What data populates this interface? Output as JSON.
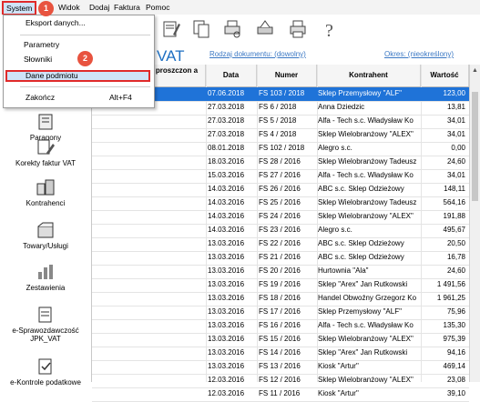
{
  "menubar": {
    "items": [
      "System",
      "Widok",
      "Dodaj",
      "Faktura",
      "Pomoc"
    ]
  },
  "dropdown": {
    "items": [
      {
        "label": "Eksport danych..."
      },
      {
        "label": "Parametry"
      },
      {
        "label": "Słowniki"
      },
      {
        "label": "Dane podmiotu"
      },
      {
        "label": "Zakończ",
        "shortcut": "Alt+F4"
      }
    ]
  },
  "badges": [
    "1",
    "2"
  ],
  "header": {
    "title": "VAT",
    "filter_doc": "Rodzaj dokumentu: (dowolny)",
    "filter_period": "Okres: (nieokreślony)"
  },
  "sidebar": {
    "items": [
      {
        "label": "Paragony",
        "icon": "receipt-icon"
      },
      {
        "label": "Korekty faktur VAT",
        "icon": "invoice-correction-icon"
      },
      {
        "label": "Kontrahenci",
        "icon": "contractors-icon"
      },
      {
        "label": "Towary/Usługi",
        "icon": "goods-icon"
      },
      {
        "label": "Zestawienia",
        "icon": "reports-icon"
      },
      {
        "label": "e-Sprawozdawczość JPK_VAT",
        "icon": "jpk-icon"
      },
      {
        "label": "e-Kontrole podatkowe",
        "icon": "tax-control-icon"
      }
    ]
  },
  "table": {
    "columns": [
      "proszczon a",
      "Data",
      "Numer",
      "Kontrahent",
      "Wartość"
    ],
    "rows": [
      {
        "date": "07.06.2018",
        "number": "FS 103 / 2018",
        "kontrahent": "Sklep Przemysłowy \"ALF\"",
        "value": "123,00",
        "selected": true
      },
      {
        "date": "27.03.2018",
        "number": "FS 6 / 2018",
        "kontrahent": "Anna Dziedzic",
        "value": "13,81"
      },
      {
        "date": "27.03.2018",
        "number": "FS 5 / 2018",
        "kontrahent": "Alfa - Tech s.c. Władysław Ko",
        "value": "34,01"
      },
      {
        "date": "27.03.2018",
        "number": "FS 4 / 2018",
        "kontrahent": "Sklep Wielobranżowy \"ALEX\"",
        "value": "34,01"
      },
      {
        "date": "08.01.2018",
        "number": "FS 102 / 2018",
        "kontrahent": "Alegro s.c.",
        "value": "0,00"
      },
      {
        "date": "18.03.2016",
        "number": "FS 28 / 2016",
        "kontrahent": "Sklep Wielobranżowy Tadeusz",
        "value": "24,60"
      },
      {
        "date": "15.03.2016",
        "number": "FS 27 / 2016",
        "kontrahent": "Alfa - Tech s.c. Władysław Ko",
        "value": "34,01"
      },
      {
        "date": "14.03.2016",
        "number": "FS 26 / 2016",
        "kontrahent": "ABC s.c. Sklep Odzieżowy",
        "value": "148,11"
      },
      {
        "date": "14.03.2016",
        "number": "FS 25 / 2016",
        "kontrahent": "Sklep Wielobranżowy Tadeusz",
        "value": "564,16"
      },
      {
        "date": "14.03.2016",
        "number": "FS 24 / 2016",
        "kontrahent": "Sklep Wielobranżowy \"ALEX\"",
        "value": "191,88"
      },
      {
        "date": "14.03.2016",
        "number": "FS 23 / 2016",
        "kontrahent": "Alegro s.c.",
        "value": "495,67"
      },
      {
        "date": "13.03.2016",
        "number": "FS 22 / 2016",
        "kontrahent": "ABC s.c. Sklep Odzieżowy",
        "value": "20,50"
      },
      {
        "date": "13.03.2016",
        "number": "FS 21 / 2016",
        "kontrahent": "ABC s.c. Sklep Odzieżowy",
        "value": "16,78"
      },
      {
        "date": "13.03.2016",
        "number": "FS 20 / 2016",
        "kontrahent": "Hurtownia \"Ala\"",
        "value": "24,60"
      },
      {
        "date": "13.03.2016",
        "number": "FS 19 / 2016",
        "kontrahent": "Sklep \"Arex\" Jan Rutkowski",
        "value": "1 491,56"
      },
      {
        "date": "13.03.2016",
        "number": "FS 18 / 2016",
        "kontrahent": "Handel Obwoźny Grzegorz Ko",
        "value": "1 961,25"
      },
      {
        "date": "13.03.2016",
        "number": "FS 17 / 2016",
        "kontrahent": "Sklep Przemysłowy \"ALF\"",
        "value": "75,96"
      },
      {
        "date": "13.03.2016",
        "number": "FS 16 / 2016",
        "kontrahent": "Alfa - Tech s.c. Władysław Ko",
        "value": "135,30"
      },
      {
        "date": "13.03.2016",
        "number": "FS 15 / 2016",
        "kontrahent": "Sklep Wielobranżowy \"ALEX\"",
        "value": "975,39"
      },
      {
        "date": "13.03.2016",
        "number": "FS 14 / 2016",
        "kontrahent": "Sklep \"Arex\" Jan Rutkowski",
        "value": "94,16"
      },
      {
        "date": "13.03.2016",
        "number": "FS 13 / 2016",
        "kontrahent": "Kiosk \"Artur\"",
        "value": "469,14"
      },
      {
        "date": "12.03.2016",
        "number": "FS 12 / 2016",
        "kontrahent": "Sklep Wielobranżowy \"ALEX\"",
        "value": "23,08"
      },
      {
        "date": "12.03.2016",
        "number": "FS 11 / 2016",
        "kontrahent": "Kiosk \"Artur\"",
        "value": "39,10"
      }
    ]
  },
  "colors": {
    "accent": "#1f73d8",
    "highlight_border": "#e02a2a",
    "badge": "#e8533f",
    "link": "#3b78c4"
  }
}
